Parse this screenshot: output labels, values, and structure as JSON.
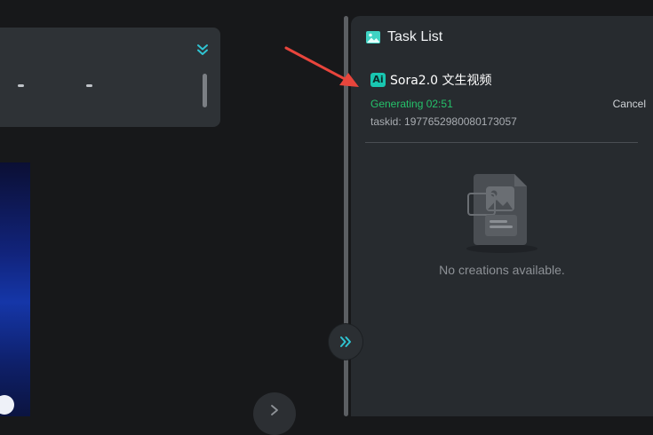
{
  "panel": {
    "title": "Task List",
    "header_icon": "image-gallery-icon"
  },
  "task": {
    "badge": "Ai",
    "name": "Sora2.0 文生视频",
    "status": "Generating 02:51",
    "cancel_label": "Cancel",
    "taskid": "taskid: 1977652980080173057"
  },
  "empty_state": {
    "icon": "image-file-icon",
    "message": "No creations available."
  },
  "icons": {
    "collapse": "double-chevron-down-icon",
    "expand": "double-chevron-right-icon",
    "next": "chevron-right-icon"
  },
  "colors": {
    "accent": "#19c7b1",
    "status_green": "#25c26a",
    "annotation_arrow": "#e8453c"
  }
}
